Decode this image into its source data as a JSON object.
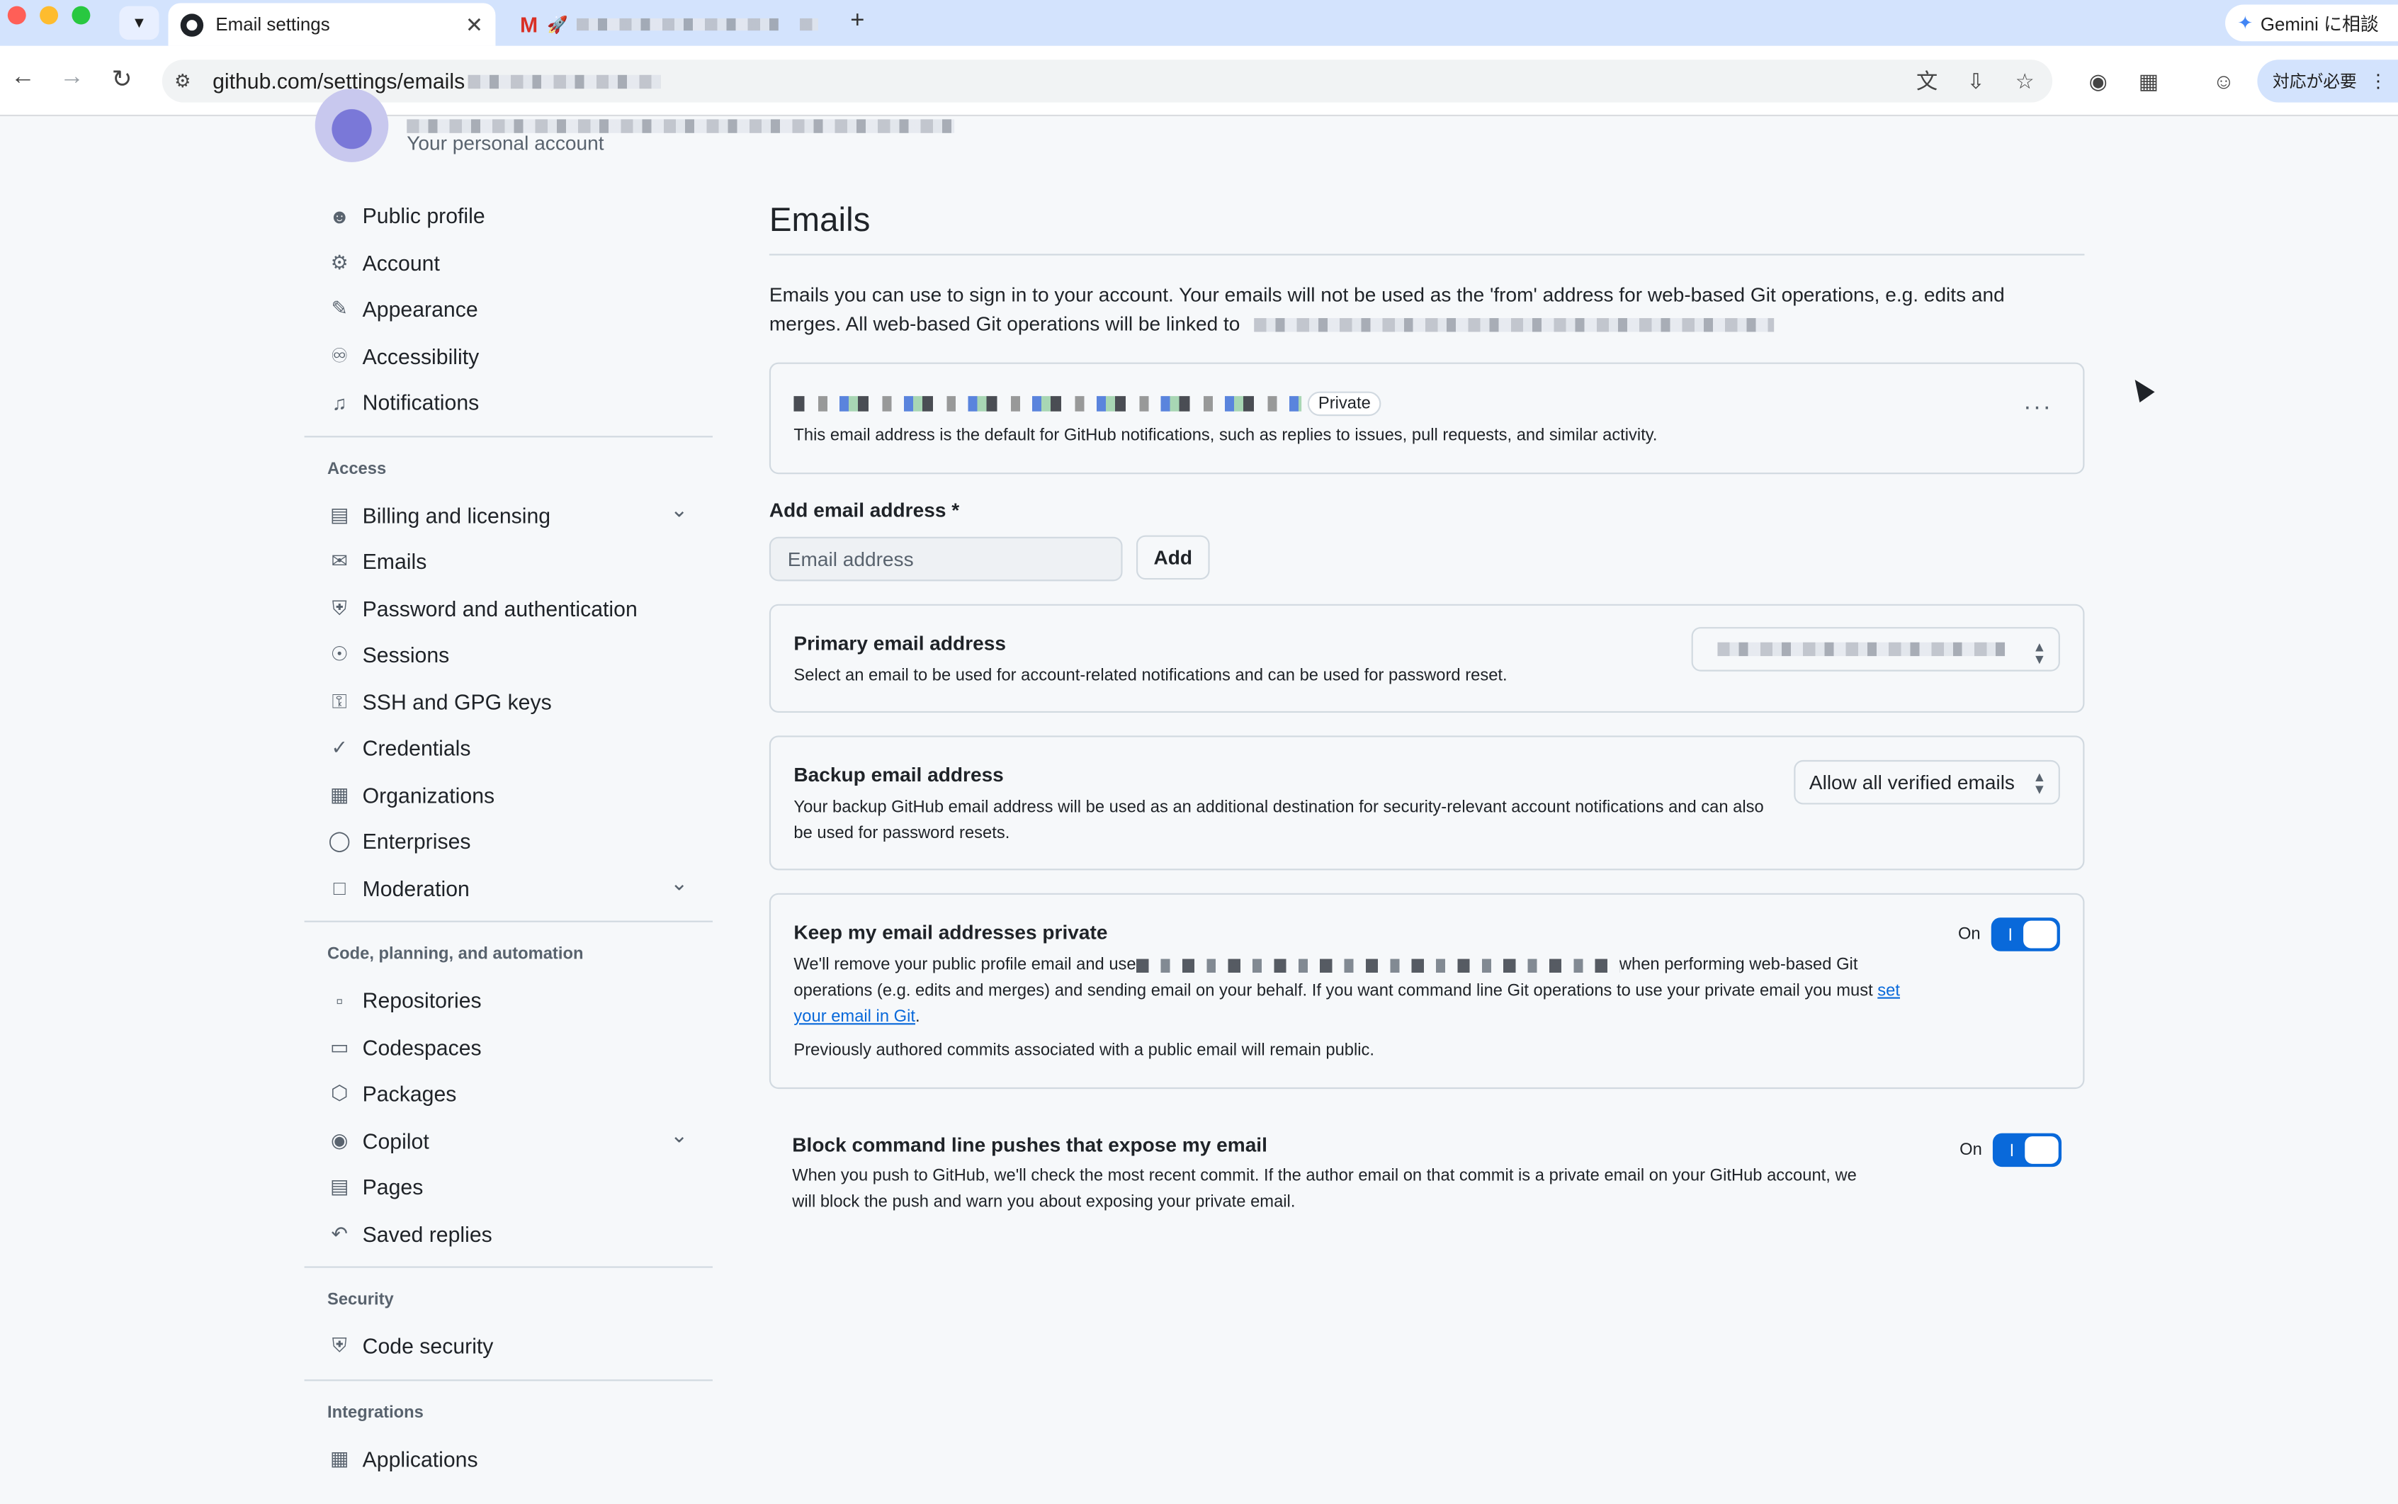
{
  "browser": {
    "active_tab_title": "Email settings",
    "new_tab_label": "+",
    "url": "github.com/settings/emails",
    "gemini_label": "Gemini に相談",
    "needs_action_label": "対応が必要"
  },
  "account": {
    "subtitle": "Your personal account"
  },
  "sidebar": {
    "items_top": [
      {
        "label": "Public profile",
        "icon": "person-icon"
      },
      {
        "label": "Account",
        "icon": "gear-icon"
      },
      {
        "label": "Appearance",
        "icon": "paintbrush-icon"
      },
      {
        "label": "Accessibility",
        "icon": "accessibility-icon"
      },
      {
        "label": "Notifications",
        "icon": "bell-icon"
      }
    ],
    "access_title": "Access",
    "access_items": [
      {
        "label": "Billing and licensing",
        "icon": "credit-card-icon",
        "expandable": true
      },
      {
        "label": "Emails",
        "icon": "mail-icon"
      },
      {
        "label": "Password and authentication",
        "icon": "shield-lock-icon"
      },
      {
        "label": "Sessions",
        "icon": "broadcast-icon"
      },
      {
        "label": "SSH and GPG keys",
        "icon": "key-icon"
      },
      {
        "label": "Credentials",
        "icon": "shield-check-icon"
      },
      {
        "label": "Organizations",
        "icon": "organization-icon"
      },
      {
        "label": "Enterprises",
        "icon": "globe-icon"
      },
      {
        "label": "Moderation",
        "icon": "report-icon",
        "expandable": true
      }
    ],
    "code_title": "Code, planning, and automation",
    "code_items": [
      {
        "label": "Repositories",
        "icon": "repo-icon"
      },
      {
        "label": "Codespaces",
        "icon": "codespaces-icon"
      },
      {
        "label": "Packages",
        "icon": "package-icon"
      },
      {
        "label": "Copilot",
        "icon": "copilot-icon",
        "expandable": true
      },
      {
        "label": "Pages",
        "icon": "browser-icon"
      },
      {
        "label": "Saved replies",
        "icon": "reply-icon"
      }
    ],
    "security_title": "Security",
    "security_items": [
      {
        "label": "Code security",
        "icon": "shield-icon"
      }
    ],
    "integrations_title": "Integrations",
    "integrations_items": [
      {
        "label": "Applications",
        "icon": "apps-icon"
      }
    ]
  },
  "main": {
    "title": "Emails",
    "intro": "Emails you can use to sign in to your account. Your emails will not be used as the 'from' address for web-based Git operations, e.g. edits and merges. All web-based Git operations will be linked to",
    "email_card": {
      "badge": "Private",
      "description": "This email address is the default for GitHub notifications, such as replies to issues, pull requests, and similar activity.",
      "menu_label": "···"
    },
    "add_email": {
      "label": "Add email address *",
      "placeholder": "Email address",
      "button": "Add"
    },
    "primary": {
      "title": "Primary email address",
      "description": "Select an email to be used for account-related notifications and can be used for password reset."
    },
    "backup": {
      "title": "Backup email address",
      "description": "Your backup GitHub email address will be used as an additional destination for security-relevant account notifications and can also be used for password resets.",
      "selected": "Allow all verified emails"
    },
    "keep_private": {
      "title": "Keep my email addresses private",
      "desc_part1": "We'll remove your public profile email and use",
      "desc_part2": "when performing web-based Git operations (e.g. edits and merges) and sending email on your behalf. If you want command line Git operations to use your private email you must",
      "link": "set your email in Git",
      "desc_end": ".",
      "note": "Previously authored commits associated with a public email will remain public.",
      "toggle_label": "On"
    },
    "block_push": {
      "title": "Block command line pushes that expose my email",
      "description": "When you push to GitHub, we'll check the most recent commit. If the author email on that commit is a private email on your GitHub account, we will block the push and warn you about exposing your private email.",
      "toggle_label": "On"
    }
  },
  "colors": {
    "accent": "#0969da",
    "border": "#d1d9e0",
    "muted": "#59636e",
    "tabbar": "#d3e3fd"
  }
}
